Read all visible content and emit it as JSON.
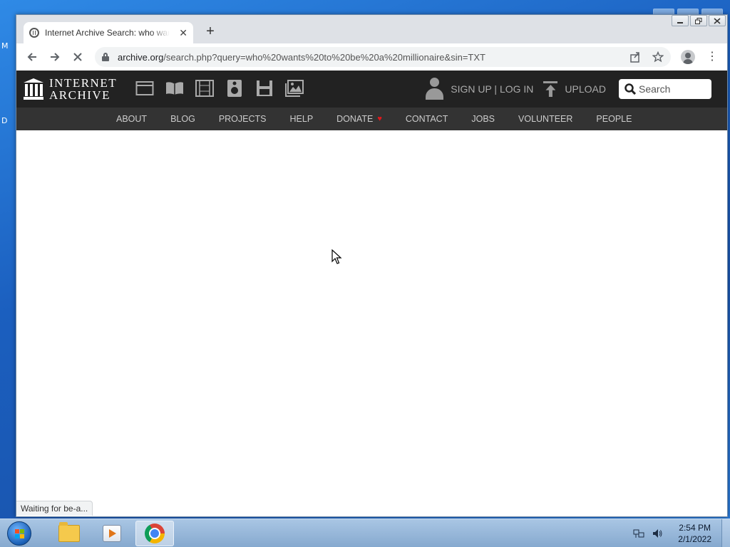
{
  "desktop": {
    "left_letters": [
      "M",
      "D"
    ]
  },
  "browser": {
    "tab": {
      "title": "Internet Archive Search: who wants to be a millionaire",
      "close_glyph": "✕"
    },
    "new_tab_glyph": "+",
    "toolbar": {
      "back_glyph": "←",
      "forward_glyph": "→",
      "stop_glyph": "✕",
      "url_host": "archive.org",
      "url_path": "/search.php?query=who%20wants%20to%20be%20a%20millionaire&sin=TXT",
      "kebab_glyph": "⋮"
    },
    "status_text": "Waiting for be-a..."
  },
  "ia": {
    "logo_line1": "INTERNET",
    "logo_line2": "ARCHIVE",
    "media_icons": [
      "web-icon",
      "texts-icon",
      "video-icon",
      "audio-icon",
      "software-icon",
      "images-icon"
    ],
    "signup_login": "SIGN UP | LOG IN",
    "upload": "UPLOAD",
    "search_placeholder": "Search",
    "nav": {
      "about": "ABOUT",
      "blog": "BLOG",
      "projects": "PROJECTS",
      "help": "HELP",
      "donate": "DONATE",
      "contact": "CONTACT",
      "jobs": "JOBS",
      "volunteer": "VOLUNTEER",
      "people": "PEOPLE"
    },
    "colors": {
      "header_bg": "#222222",
      "nav_bg": "#333333",
      "donate_heart": "#e0191c"
    }
  },
  "taskbar": {
    "items": [
      "windows-explorer",
      "windows-media-player",
      "google-chrome"
    ],
    "active_item": "google-chrome",
    "clock_time": "2:54 PM",
    "clock_date": "2/1/2022"
  }
}
